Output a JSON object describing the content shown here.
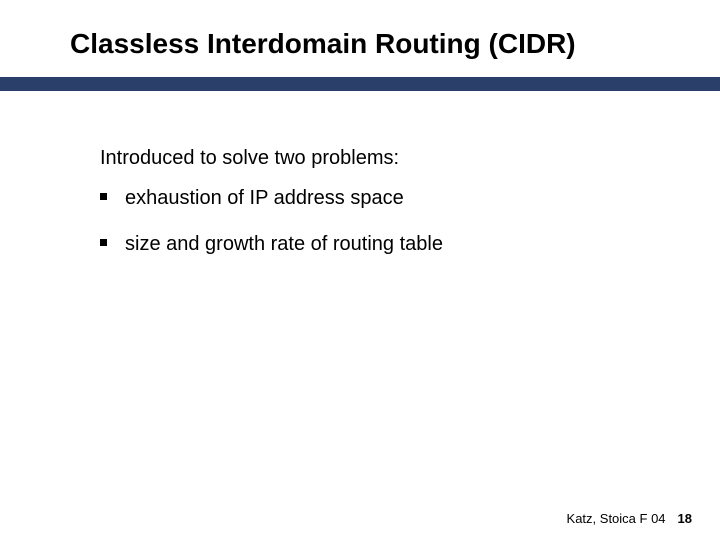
{
  "title": "Classless Interdomain Routing (CIDR)",
  "intro": "Introduced to solve two problems:",
  "bullets": [
    "exhaustion of IP address space",
    "size and growth rate of routing table"
  ],
  "footer": {
    "credit": "Katz, Stoica F 04",
    "page": "18"
  }
}
